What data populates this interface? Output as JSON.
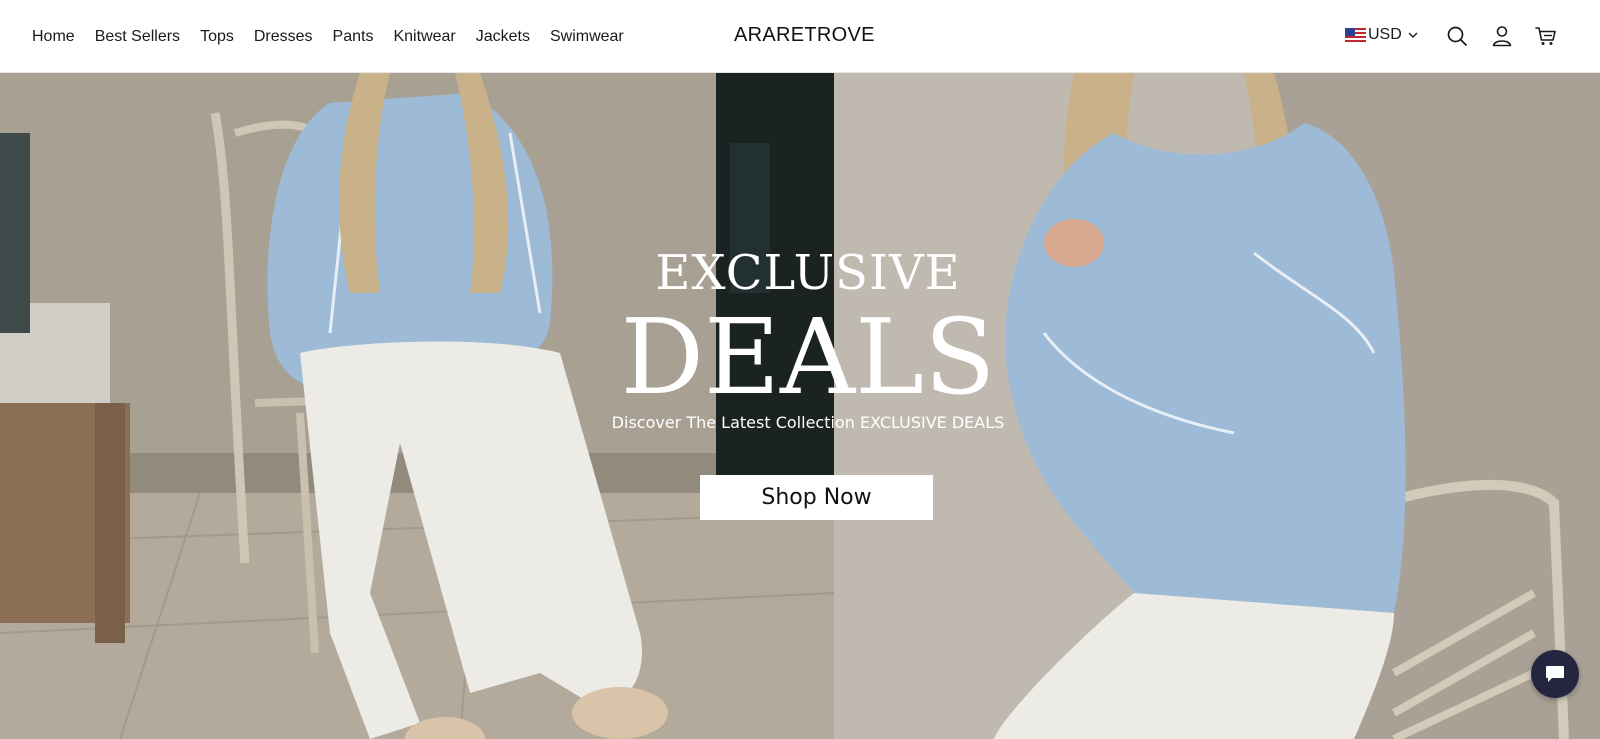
{
  "header": {
    "nav": [
      "Home",
      "Best Sellers",
      "Tops",
      "Dresses",
      "Pants",
      "Knitwear",
      "Jackets",
      "Swimwear"
    ],
    "logo": "ARARETROVE",
    "currency": "USD",
    "icons": [
      "us-flag-icon",
      "chevron-down-icon",
      "search-icon",
      "account-icon",
      "cart-icon"
    ]
  },
  "hero": {
    "eyebrow": "EXCLUSIVE",
    "title": "DEALS",
    "subtitle": "Discover The Latest Collection EXCLUSIVE DEALS",
    "cta": "Shop Now"
  },
  "chat": {
    "icon": "chat-icon"
  },
  "colors": {
    "header_bg": "#ffffff",
    "text": "#1a1a1a",
    "sweater_blue": "#9dbad6",
    "pants_white": "#ecebe6",
    "chat_bg": "#24263f"
  }
}
